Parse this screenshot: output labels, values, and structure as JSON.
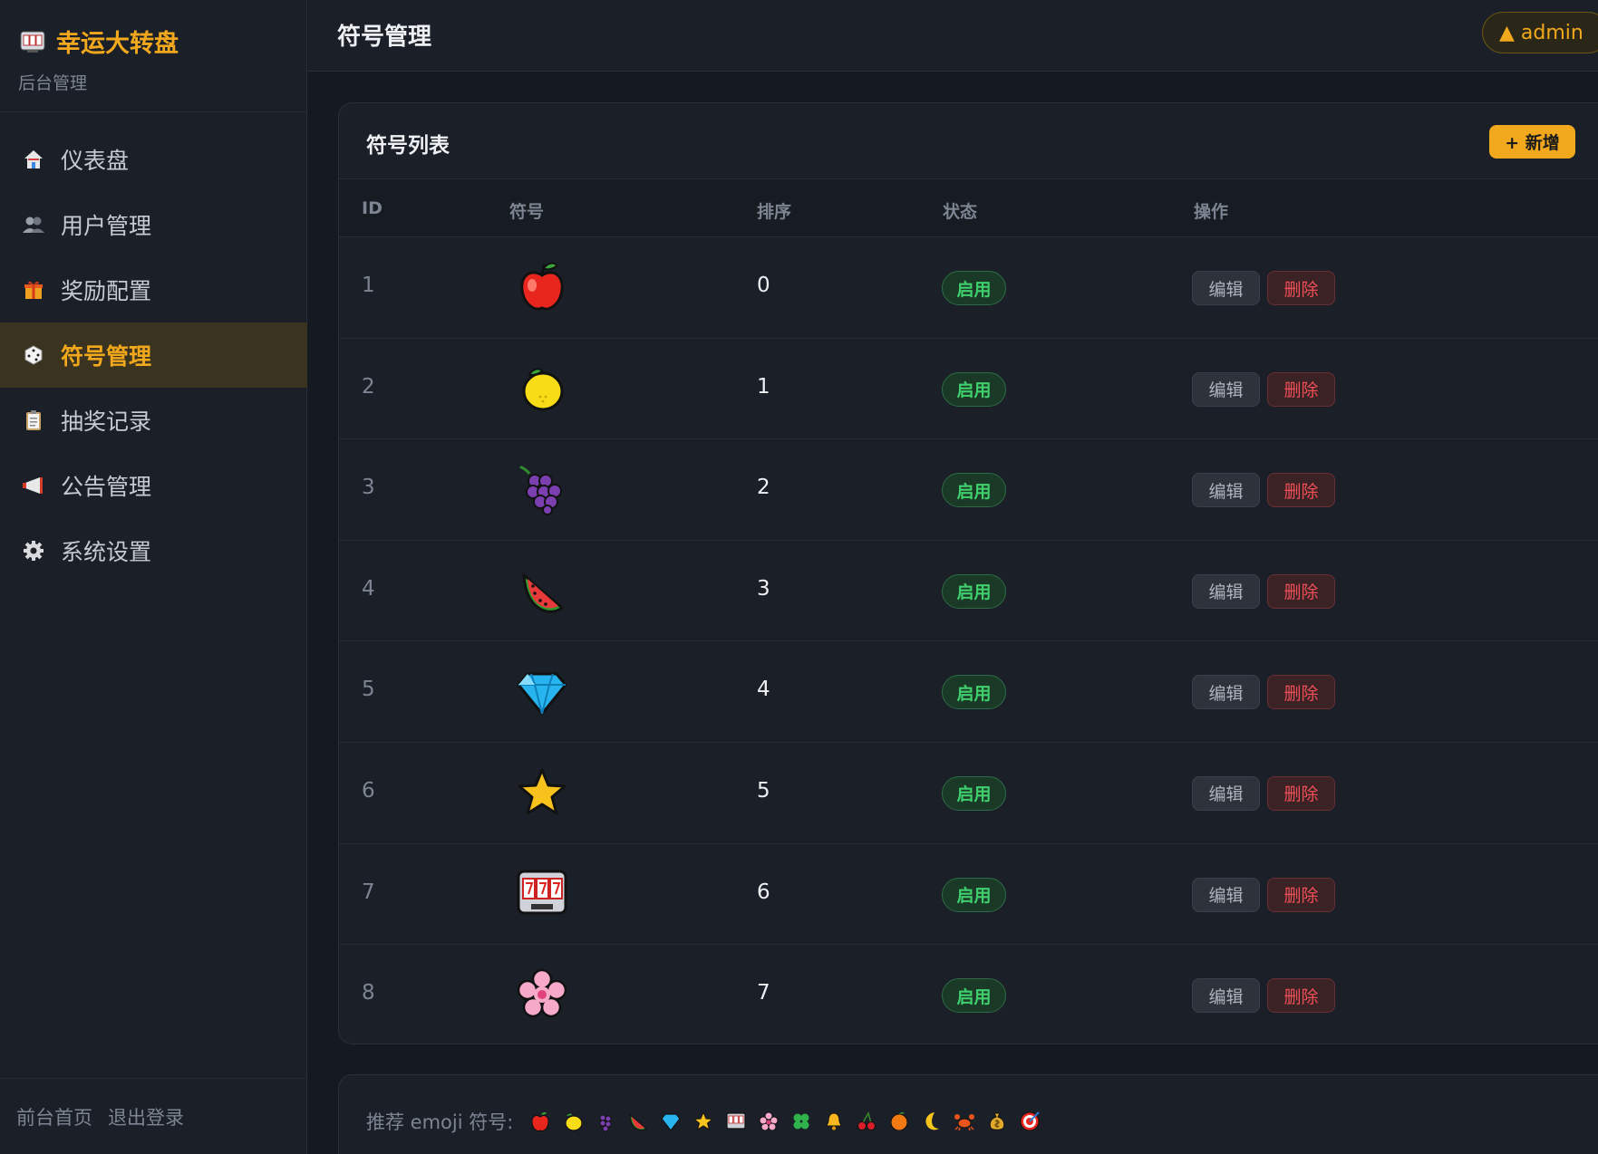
{
  "sidebar": {
    "brand_title": "幸运大转盘",
    "brand_sub": "后台管理",
    "items": [
      {
        "label": "仪表盘",
        "icon": "house-icon"
      },
      {
        "label": "用户管理",
        "icon": "users-icon"
      },
      {
        "label": "奖励配置",
        "icon": "gift-icon"
      },
      {
        "label": "符号管理",
        "icon": "dice-icon",
        "active": true
      },
      {
        "label": "抽奖记录",
        "icon": "clipboard-icon"
      },
      {
        "label": "公告管理",
        "icon": "megaphone-icon"
      },
      {
        "label": "系统设置",
        "icon": "gear-icon"
      }
    ],
    "footer": {
      "home": "前台首页",
      "logout": "退出登录"
    }
  },
  "header": {
    "title": "符号管理",
    "user": "▲ admin"
  },
  "card": {
    "title": "符号列表",
    "add_label": "+ 新增",
    "columns": {
      "id": "ID",
      "symbol": "符号",
      "sort": "排序",
      "status": "状态",
      "actions": "操作"
    },
    "rows": [
      {
        "id": "1",
        "symbol": "apple-icon",
        "sort": "0",
        "status": "启用"
      },
      {
        "id": "2",
        "symbol": "lemon-icon",
        "sort": "1",
        "status": "启用"
      },
      {
        "id": "3",
        "symbol": "grapes-icon",
        "sort": "2",
        "status": "启用"
      },
      {
        "id": "4",
        "symbol": "watermelon-icon",
        "sort": "3",
        "status": "启用"
      },
      {
        "id": "5",
        "symbol": "gem-icon",
        "sort": "4",
        "status": "启用"
      },
      {
        "id": "6",
        "symbol": "star-icon",
        "sort": "5",
        "status": "启用"
      },
      {
        "id": "7",
        "symbol": "slot-machine-icon",
        "sort": "6",
        "status": "启用"
      },
      {
        "id": "8",
        "symbol": "cherry-blossom-icon",
        "sort": "7",
        "status": "启用"
      }
    ],
    "edit_label": "编辑",
    "delete_label": "删除"
  },
  "recommend": {
    "label": "推荐 emoji 符号:",
    "icons": [
      "apple-icon",
      "lemon-icon",
      "grapes-icon",
      "watermelon-icon",
      "gem-icon",
      "star-icon",
      "slot-machine-icon",
      "cherry-blossom-icon",
      "clover-icon",
      "bell-icon",
      "cherries-icon",
      "tangerine-icon",
      "moon-icon",
      "crab-icon",
      "money-bag-icon",
      "target-icon"
    ]
  },
  "colors": {
    "accent": "#f2a81c",
    "success": "#3fcf6c",
    "danger": "#ef4f57",
    "bg": "#151a22",
    "panel": "#1b2028"
  }
}
